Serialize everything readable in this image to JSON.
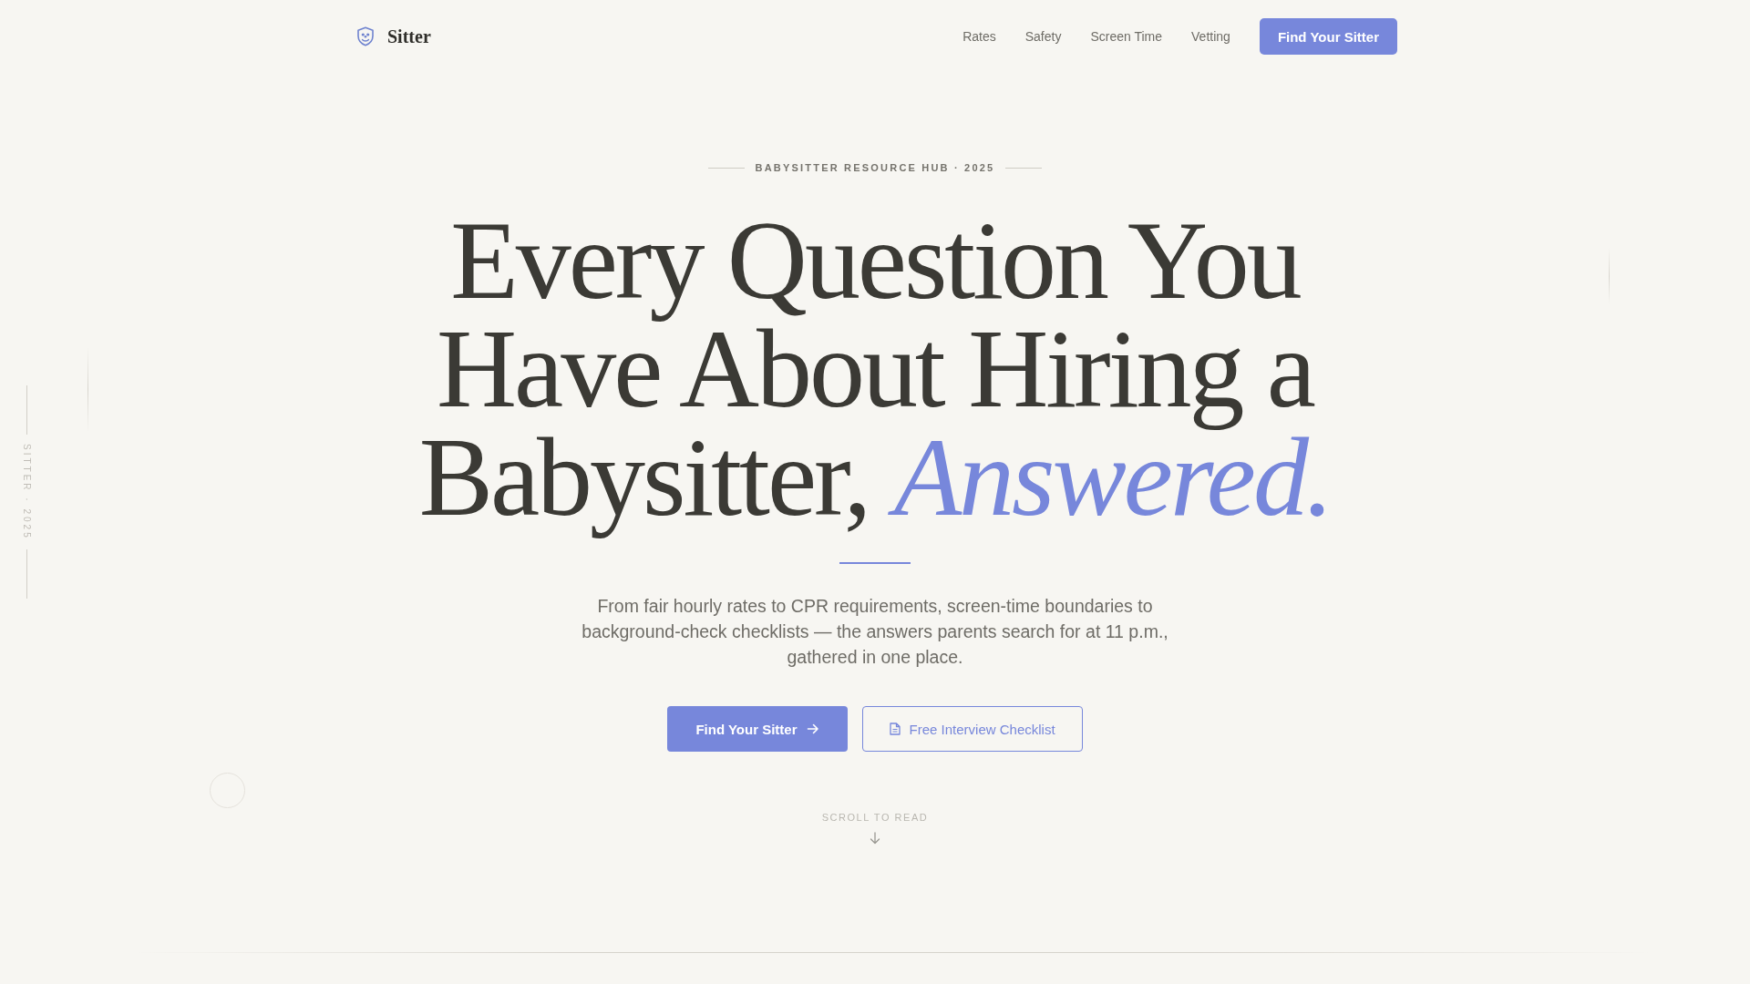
{
  "header": {
    "brand": "Sitter",
    "nav": [
      "Rates",
      "Safety",
      "Screen Time",
      "Vetting"
    ],
    "cta": "Find Your Sitter"
  },
  "side_label": "SITTER · 2025",
  "hero": {
    "eyebrow": "BABYSITTER RESOURCE HUB · 2025",
    "title": "Every Question You Have About Hiring a Babysitter, *Answered.*",
    "lede": "From fair hourly rates to CPR requirements, screen-time boundaries to background-check checklists — the answers parents search for at 11 p.m., gathered in one place.",
    "buttons": [
      {
        "kind": "primary",
        "label": "Find Your Sitter"
      },
      {
        "kind": "secondary",
        "label": "Free Interview Checklist"
      }
    ],
    "scroll_hint": "SCROLL TO READ"
  }
}
